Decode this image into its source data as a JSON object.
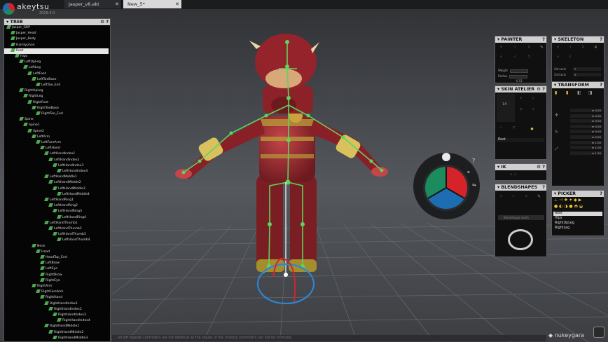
{
  "app": {
    "name": "akeytsu",
    "version": "2019.4.0"
  },
  "tabs": [
    {
      "label": "Jasper_v8.akt",
      "active": false
    },
    {
      "label": "New_5*",
      "active": true
    }
  ],
  "tree": {
    "title": "TREE",
    "rows": [
      {
        "label": "Jasper_GRP",
        "depth": 0
      },
      {
        "label": "Jasper_Head",
        "depth": 1
      },
      {
        "label": "Jasper_Body",
        "depth": 1
      },
      {
        "label": "Hairdyphon",
        "depth": 1
      },
      {
        "label": "Root",
        "depth": 1,
        "selected": true
      },
      {
        "label": "Hips",
        "depth": 2
      },
      {
        "label": "LeftUpLeg",
        "depth": 3
      },
      {
        "label": "LeftLeg",
        "depth": 4
      },
      {
        "label": "LeftFoot",
        "depth": 5
      },
      {
        "label": "LeftToeBase",
        "depth": 6
      },
      {
        "label": "LeftToe_End",
        "depth": 7
      },
      {
        "label": "RightUpLeg",
        "depth": 3
      },
      {
        "label": "RightLeg",
        "depth": 4
      },
      {
        "label": "RightFoot",
        "depth": 5
      },
      {
        "label": "RightToeBase",
        "depth": 6
      },
      {
        "label": "RightToe_End",
        "depth": 7
      },
      {
        "label": "Spine",
        "depth": 3
      },
      {
        "label": "Spine1",
        "depth": 4
      },
      {
        "label": "Spine2",
        "depth": 5
      },
      {
        "label": "LeftArm",
        "depth": 6
      },
      {
        "label": "LeftForeArm",
        "depth": 7
      },
      {
        "label": "LeftHand",
        "depth": 8
      },
      {
        "label": "LeftHandIndex1",
        "depth": 9
      },
      {
        "label": "LeftHandIndex2",
        "depth": 10
      },
      {
        "label": "LeftHandIndex3",
        "depth": 11
      },
      {
        "label": "LeftHandIndex4",
        "depth": 12
      },
      {
        "label": "LeftHandMiddle1",
        "depth": 9
      },
      {
        "label": "LeftHandMiddle2",
        "depth": 10
      },
      {
        "label": "LeftHandMiddle3",
        "depth": 11
      },
      {
        "label": "LeftHandMiddle4",
        "depth": 12
      },
      {
        "label": "LeftHandRing1",
        "depth": 9
      },
      {
        "label": "LeftHandRing2",
        "depth": 10
      },
      {
        "label": "LeftHandRing3",
        "depth": 11
      },
      {
        "label": "LeftHandRing4",
        "depth": 12
      },
      {
        "label": "LeftHandThumb1",
        "depth": 9
      },
      {
        "label": "LeftHandThumb2",
        "depth": 10
      },
      {
        "label": "LeftHandThumb3",
        "depth": 11
      },
      {
        "label": "LeftHandThumb4",
        "depth": 12
      },
      {
        "label": "Neck",
        "depth": 6
      },
      {
        "label": "Head",
        "depth": 7
      },
      {
        "label": "HeadTop_End",
        "depth": 8
      },
      {
        "label": "LeftBrow",
        "depth": 8
      },
      {
        "label": "LeftEye",
        "depth": 8
      },
      {
        "label": "RightBrow",
        "depth": 8
      },
      {
        "label": "RightEye",
        "depth": 8
      },
      {
        "label": "RightArm",
        "depth": 6
      },
      {
        "label": "RightForeArm",
        "depth": 7
      },
      {
        "label": "RightHand",
        "depth": 8
      },
      {
        "label": "RightHandIndex1",
        "depth": 9
      },
      {
        "label": "RightHandIndex2",
        "depth": 10
      },
      {
        "label": "RightHandIndex3",
        "depth": 11
      },
      {
        "label": "RightHandIndex4",
        "depth": 12
      },
      {
        "label": "RightHandMiddle1",
        "depth": 9
      },
      {
        "label": "RightHandMiddle2",
        "depth": 10
      },
      {
        "label": "RightHandMiddle3",
        "depth": 11
      }
    ]
  },
  "painter": {
    "title": "PAINTER",
    "weight_label": "Weight",
    "radius_label": "Radius",
    "value": "0.51"
  },
  "skeleton": {
    "title": "SKELETON",
    "aim_axis_label": "Aim axis",
    "aim_axis_value": "Y",
    "second_axis_label": "2nd axis",
    "second_axis_value": "Z"
  },
  "transform": {
    "title": "TRANSFORM",
    "values": [
      "0.00",
      "0.00",
      "0.00",
      "0.00",
      "0.00",
      "0.00",
      "1.00",
      "1.00",
      "1.00"
    ],
    "unit": "m"
  },
  "skin_atelier": {
    "title": "SKIN ATELIER",
    "value": "14",
    "selected_item": "Root"
  },
  "ik": {
    "title": "IK"
  },
  "blendshapes": {
    "title": "BLENDSHAPES",
    "dropdown": "Blendshape mesh"
  },
  "picker": {
    "title": "PICKER",
    "items": [
      "Root",
      "Hips",
      "RightUpLeg",
      "RightLeg"
    ],
    "selected": "Root"
  },
  "status_text": "... ed left bipedal controllers are not identical so the values of the missing controllers can not be mirrored...",
  "brand": "nukeygara",
  "colors": {
    "accent_red": "#d6232a",
    "accent_green": "#1c8b5e",
    "accent_blue": "#1d6db3",
    "bone": "#5fd35f"
  }
}
